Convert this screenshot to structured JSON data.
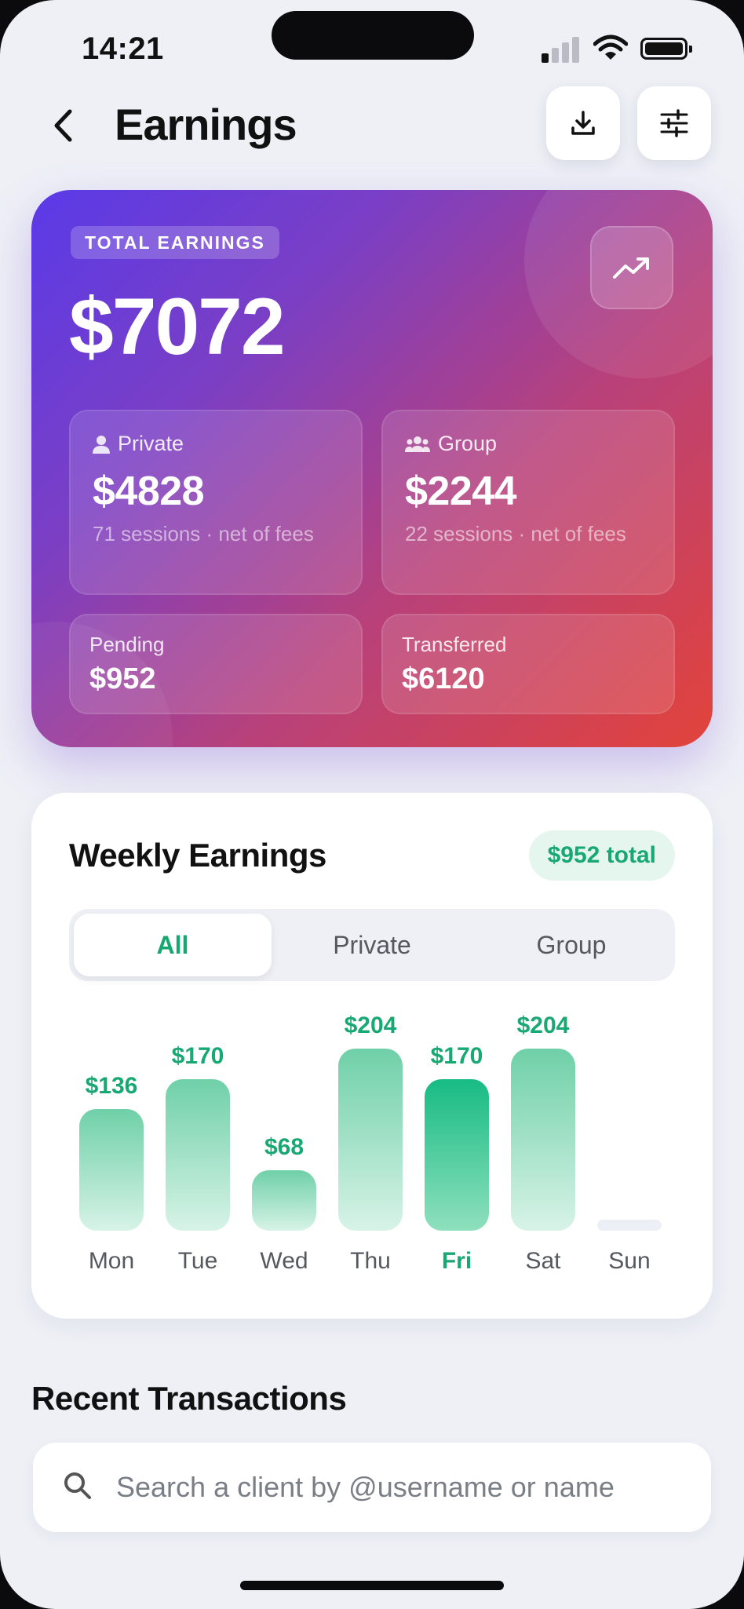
{
  "status": {
    "time": "14:21"
  },
  "header": {
    "title": "Earnings",
    "download_icon": "download-icon",
    "filter_icon": "sliders-icon"
  },
  "hero": {
    "badge": "TOTAL EARNINGS",
    "total": "$7072",
    "private": {
      "label": "Private",
      "value": "$4828",
      "sub": "71 sessions · net of fees"
    },
    "group": {
      "label": "Group",
      "value": "$2244",
      "sub": "22 sessions · net of fees"
    },
    "pending": {
      "label": "Pending",
      "value": "$952"
    },
    "transferred": {
      "label": "Transferred",
      "value": "$6120"
    }
  },
  "weekly": {
    "title": "Weekly Earnings",
    "total": "$952 total",
    "tabs": [
      {
        "label": "All",
        "active": true
      },
      {
        "label": "Private",
        "active": false
      },
      {
        "label": "Group",
        "active": false
      }
    ]
  },
  "chart_data": {
    "type": "bar",
    "categories": [
      "Mon",
      "Tue",
      "Wed",
      "Thu",
      "Fri",
      "Sat",
      "Sun"
    ],
    "values": [
      136,
      170,
      68,
      204,
      170,
      204,
      0
    ],
    "labels": [
      "$136",
      "$170",
      "$68",
      "$204",
      "$170",
      "$204",
      ""
    ],
    "highlight": "Fri",
    "colors": {
      "bar_top": "#6fd0a8",
      "bar_bottom": "#d7f3e7",
      "highlight_top": "#18bb84",
      "text": "#18a873"
    }
  },
  "recent": {
    "title": "Recent Transactions",
    "search_placeholder": "Search a client by @username or name",
    "search_value": ""
  }
}
